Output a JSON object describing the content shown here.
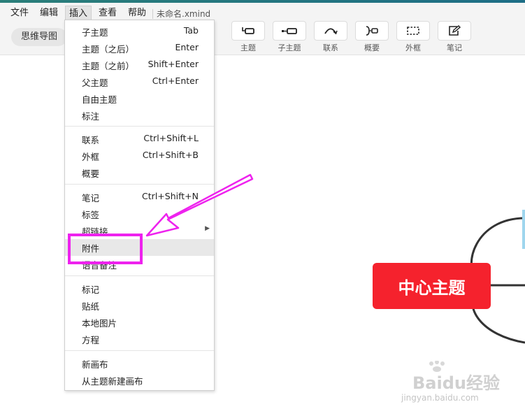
{
  "menubar": {
    "items": [
      "文件",
      "编辑",
      "插入",
      "查看",
      "帮助"
    ],
    "active": "插入",
    "doc_title": "未命名.xmind"
  },
  "toolbar": {
    "view_mode": "思维导图",
    "buttons": [
      {
        "label": "主题",
        "icon": "topic-icon"
      },
      {
        "label": "子主题",
        "icon": "subtopic-icon"
      },
      {
        "label": "联系",
        "icon": "relationship-icon"
      },
      {
        "label": "概要",
        "icon": "summary-icon"
      },
      {
        "label": "外框",
        "icon": "boundary-icon"
      },
      {
        "label": "笔记",
        "icon": "note-icon"
      }
    ]
  },
  "insert_menu": {
    "groups": [
      [
        {
          "label": "子主题",
          "shortcut": "Tab"
        },
        {
          "label": "主题（之后）",
          "shortcut": "Enter"
        },
        {
          "label": "主题（之前）",
          "shortcut": "Shift+Enter"
        },
        {
          "label": "父主题",
          "shortcut": "Ctrl+Enter"
        },
        {
          "label": "自由主题",
          "shortcut": ""
        },
        {
          "label": "标注",
          "shortcut": ""
        }
      ],
      [
        {
          "label": "联系",
          "shortcut": "Ctrl+Shift+L"
        },
        {
          "label": "外框",
          "shortcut": "Ctrl+Shift+B"
        },
        {
          "label": "概要",
          "shortcut": ""
        }
      ],
      [
        {
          "label": "笔记",
          "shortcut": "Ctrl+Shift+N"
        },
        {
          "label": "标签",
          "shortcut": ""
        },
        {
          "label": "超链接",
          "shortcut": "",
          "submenu": true
        },
        {
          "label": "附件",
          "shortcut": "",
          "highlighted": true
        },
        {
          "label": "语音备注",
          "shortcut": ""
        }
      ],
      [
        {
          "label": "标记",
          "shortcut": ""
        },
        {
          "label": "贴纸",
          "shortcut": ""
        },
        {
          "label": "本地图片",
          "shortcut": ""
        },
        {
          "label": "方程",
          "shortcut": ""
        }
      ],
      [
        {
          "label": "新画布",
          "shortcut": ""
        },
        {
          "label": "从主题新建画布",
          "shortcut": ""
        }
      ]
    ]
  },
  "canvas": {
    "central_topic": "中心主题",
    "central_color": "#f5222d"
  },
  "annotation": {
    "color": "#ee22ee"
  },
  "watermark": {
    "text": "Baidu经验",
    "url": "jingyan.baidu.com"
  }
}
